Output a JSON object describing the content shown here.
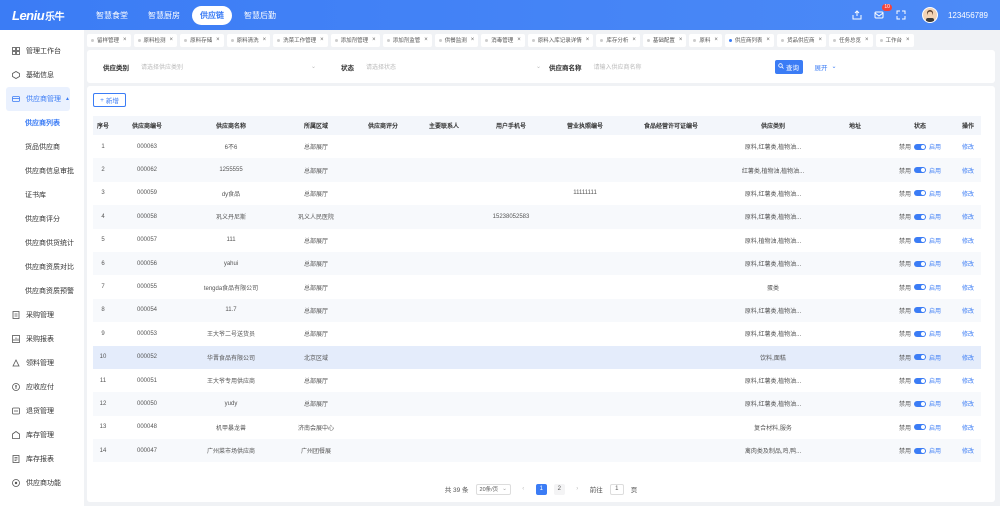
{
  "app": {
    "logo_text": "Leniu",
    "logo_cn": "乐牛",
    "username": "123456789",
    "badge_count": "10",
    "accent": "#3b7cf5"
  },
  "topnav": [
    {
      "label": "智慧食堂"
    },
    {
      "label": "智慧厨房"
    },
    {
      "label": "供应链"
    },
    {
      "label": "智慧后勤"
    }
  ],
  "sidebar": {
    "items": [
      {
        "label": "管理工作台",
        "icon": "dashboard-icon"
      },
      {
        "label": "基础信息",
        "icon": "info-icon"
      },
      {
        "label": "供应商管理",
        "icon": "supplier-icon"
      },
      {
        "label": "采购管理",
        "icon": "purchase-icon"
      },
      {
        "label": "采购报表",
        "icon": "report-icon"
      },
      {
        "label": "领料管理",
        "icon": "material-icon"
      },
      {
        "label": "应收应付",
        "icon": "money-icon"
      },
      {
        "label": "退货管理",
        "icon": "return-icon"
      },
      {
        "label": "库存管理",
        "icon": "inventory-icon"
      },
      {
        "label": "库存报表",
        "icon": "stock-report-icon"
      },
      {
        "label": "供应商功能",
        "icon": "function-icon"
      }
    ],
    "sub_items": [
      {
        "label": "供应商列表"
      },
      {
        "label": "货品供应商"
      },
      {
        "label": "供应商信息审批"
      },
      {
        "label": "证书库"
      },
      {
        "label": "供应商评分"
      },
      {
        "label": "供应商供货统计"
      },
      {
        "label": "供应商资质对比"
      },
      {
        "label": "供应商资质预警"
      }
    ]
  },
  "tabs": [
    {
      "label": "留样管理"
    },
    {
      "label": "原料检测"
    },
    {
      "label": "原料存储"
    },
    {
      "label": "原料清洗"
    },
    {
      "label": "洗菜工作管理"
    },
    {
      "label": "添加剂管理"
    },
    {
      "label": "添加剂监管"
    },
    {
      "label": "供餐监测"
    },
    {
      "label": "消毒管理"
    },
    {
      "label": "原料入库记录详情"
    },
    {
      "label": "库存分析"
    },
    {
      "label": "基础配置"
    },
    {
      "label": "原料"
    },
    {
      "label": "供应商列表"
    },
    {
      "label": "货品供应商"
    },
    {
      "label": "任务总览"
    },
    {
      "label": "工作台"
    }
  ],
  "filters": {
    "category_label": "供应类别",
    "category_placeholder": "请选择供应类别",
    "status_label": "状态",
    "status_placeholder": "请选择状态",
    "name_label": "供应商名称",
    "name_placeholder": "请输入供应商名称",
    "search_button": "查询",
    "expand_button": "展开"
  },
  "add_button": "新增",
  "table": {
    "headers": [
      "序号",
      "供应商编号",
      "供应商名称",
      "所属区域",
      "供应商评分",
      "主要联系人",
      "用户手机号",
      "营业执照编号",
      "食品经营许可证编号",
      "供应类别",
      "地址",
      "状态",
      "操作"
    ],
    "disable_label": "禁用",
    "enable_label": "启用",
    "edit_label": "修改",
    "rows": [
      {
        "no": "1",
        "code": "000063",
        "name": "6不6",
        "area": "总部展厅",
        "score": "",
        "contact": "",
        "phone": "",
        "license": "",
        "food_license": "",
        "category": "原料,红薯类,植物油...",
        "address": ""
      },
      {
        "no": "2",
        "code": "000062",
        "name": "1255555",
        "area": "总部展厅",
        "score": "",
        "contact": "",
        "phone": "",
        "license": "",
        "food_license": "",
        "category": "红薯类,植物油,植物油...",
        "address": ""
      },
      {
        "no": "3",
        "code": "000059",
        "name": "dy食品",
        "area": "总部展厅",
        "score": "",
        "contact": "",
        "phone": "",
        "license": "11111111",
        "food_license": "",
        "category": "原料,红薯类,植物油...",
        "address": ""
      },
      {
        "no": "4",
        "code": "000058",
        "name": "巩义丹尼斯",
        "area": "巩义人民医院",
        "score": "",
        "contact": "",
        "phone": "15238052583",
        "license": "",
        "food_license": "",
        "category": "原料,红薯类,植物油...",
        "address": ""
      },
      {
        "no": "5",
        "code": "000057",
        "name": "111",
        "area": "总部展厅",
        "score": "",
        "contact": "",
        "phone": "",
        "license": "",
        "food_license": "",
        "category": "原料,植物油,植物油...",
        "address": ""
      },
      {
        "no": "6",
        "code": "000056",
        "name": "yahui",
        "area": "总部展厅",
        "score": "",
        "contact": "",
        "phone": "",
        "license": "",
        "food_license": "",
        "category": "原料,红薯类,植物油...",
        "address": ""
      },
      {
        "no": "7",
        "code": "000055",
        "name": "tengda食品有限公司",
        "area": "总部展厅",
        "score": "",
        "contact": "",
        "phone": "",
        "license": "",
        "food_license": "",
        "category": "蛋类",
        "address": ""
      },
      {
        "no": "8",
        "code": "000054",
        "name": "11.7",
        "area": "总部展厅",
        "score": "",
        "contact": "",
        "phone": "",
        "license": "",
        "food_license": "",
        "category": "原料,红薯类,植物油...",
        "address": ""
      },
      {
        "no": "9",
        "code": "000053",
        "name": "王大爷二号送货员",
        "area": "总部展厅",
        "score": "",
        "contact": "",
        "phone": "",
        "license": "",
        "food_license": "",
        "category": "原料,红薯类,植物油...",
        "address": ""
      },
      {
        "no": "10",
        "code": "000052",
        "name": "华晋食品有限公司",
        "area": "北京区域",
        "score": "",
        "contact": "",
        "phone": "",
        "license": "",
        "food_license": "",
        "category": "饮料,面糕",
        "address": ""
      },
      {
        "no": "11",
        "code": "000051",
        "name": "王大爷专用供应商",
        "area": "总部展厅",
        "score": "",
        "contact": "",
        "phone": "",
        "license": "",
        "food_license": "",
        "category": "原料,红薯类,植物油...",
        "address": ""
      },
      {
        "no": "12",
        "code": "000050",
        "name": "yudy",
        "area": "总部展厅",
        "score": "",
        "contact": "",
        "phone": "",
        "license": "",
        "food_license": "",
        "category": "原料,红薯类,植物油...",
        "address": ""
      },
      {
        "no": "13",
        "code": "000048",
        "name": "机甲暴龙兽",
        "area": "济南会展中心",
        "score": "",
        "contact": "",
        "phone": "",
        "license": "",
        "food_license": "",
        "category": "复合材料,服务",
        "address": ""
      },
      {
        "no": "14",
        "code": "000047",
        "name": "广州菜市场供应商",
        "area": "广州团餐展",
        "score": "",
        "contact": "",
        "phone": "",
        "license": "",
        "food_license": "",
        "category": "禽肉类及制品,鸡,鸭...",
        "address": ""
      }
    ]
  },
  "pagination": {
    "total": "共 39 条",
    "page_size": "20条/页",
    "pages": [
      "1",
      "2"
    ],
    "goto_label": "前往",
    "goto_value": "1",
    "page_unit": "页"
  }
}
